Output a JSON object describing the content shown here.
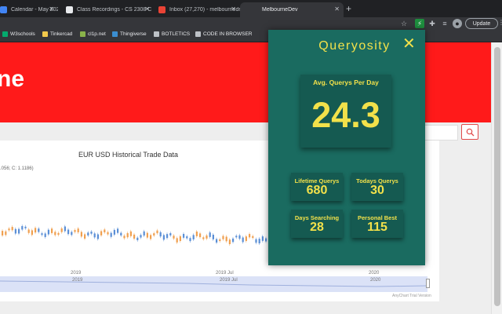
{
  "browser": {
    "tabs": [
      {
        "title": "Calendar - May 2021",
        "active": false
      },
      {
        "title": "Class Recordings - CS 2308 C",
        "active": false
      },
      {
        "title": "Inbox (27,270) - melbournedr",
        "active": false
      },
      {
        "title": "MelbourneDev",
        "active": true
      }
    ],
    "new_tab_glyph": "+",
    "update_label": "Update"
  },
  "bookmarks": [
    {
      "label": "W3schools",
      "icon": "w3schools-icon",
      "color": "#04aa6d"
    },
    {
      "label": "Tinkercad",
      "icon": "tinkercad-icon",
      "color": "#f2c94c"
    },
    {
      "label": "cl1p.net",
      "icon": "clip-icon",
      "color": "#8ab34a"
    },
    {
      "label": "Thingiverse",
      "icon": "thingiverse-icon",
      "color": "#3b8ed0"
    },
    {
      "label": "BOTLETICS",
      "icon": "folder-icon",
      "color": "#bdc1c6"
    },
    {
      "label": "CODE IN BROWSER",
      "icon": "folder-icon",
      "color": "#bdc1c6"
    }
  ],
  "page": {
    "hero_text": "ne",
    "chart_title": "EUR USD Historical Trade Data",
    "chart_subtitle": ".056; C: 1.1186)",
    "axis_labels": [
      "2019",
      "2019 Jul",
      "2020"
    ],
    "navigator_labels": [
      "2019",
      "2019 Jul",
      "2020"
    ],
    "credit": "AnyChart Trial Version"
  },
  "popup": {
    "title": "Queryosity",
    "close_glyph": "✕",
    "main": {
      "label": "Avg. Querys Per Day",
      "value": "24.3"
    },
    "stats": [
      {
        "label": "Lifetime Querys",
        "value": "680"
      },
      {
        "label": "Todays Querys",
        "value": "30"
      },
      {
        "label": "Days Searching",
        "value": "28"
      },
      {
        "label": "Personal Best",
        "value": "115"
      }
    ]
  },
  "colors": {
    "popup_bg": "#1a6b60",
    "popup_card": "#155a51",
    "popup_text": "#f2e14a",
    "hero_red": "#ff1a1a",
    "candle_up": "#5b8fd6",
    "candle_down": "#f0a050"
  }
}
